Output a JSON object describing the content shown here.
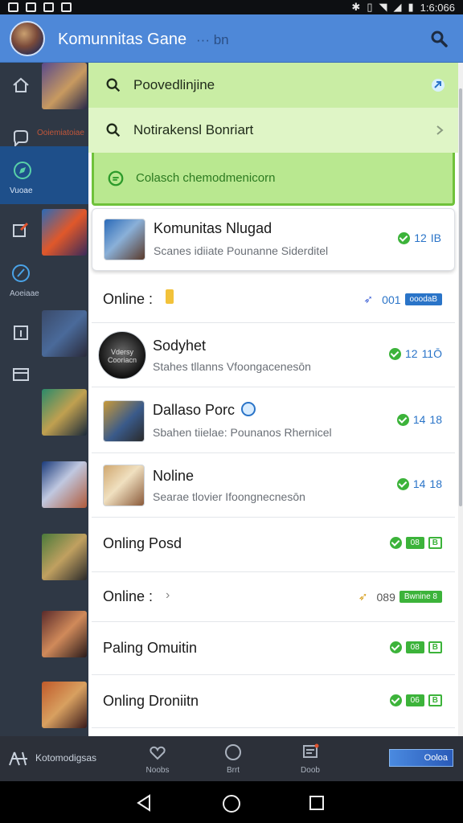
{
  "status": {
    "time": "1:6:066"
  },
  "appbar": {
    "title": "Komunnitas Gane",
    "suffix": "··· bn",
    "search_icon": "search-icon"
  },
  "rail": {
    "items": [
      {
        "label": ""
      },
      {
        "label": "Ooiemiatoiae"
      },
      {
        "label": "Vuoae"
      },
      {
        "label": ""
      },
      {
        "label": "Aoeiaae"
      },
      {
        "label": ""
      },
      {
        "label": ""
      }
    ]
  },
  "search": {
    "row1": "Poovedlinjine",
    "row2": "Notirakensl Bonriart",
    "row3": "Colasch chemodmenicorn"
  },
  "cards": [
    {
      "title": "Komunitas Nlugad",
      "subtitle": "Scanes idiiate  Pounanne Siderditel",
      "count": "12",
      "badge": "IB"
    },
    {
      "title": "Online :",
      "count": "001",
      "pill": "ooodaB"
    },
    {
      "title": "Sodyhet",
      "subtitle": "Stahes tllanns Vfoongacenesōn",
      "count": "12",
      "badge": "11Ō",
      "avatar_text": "Vdersy Cooriacn"
    },
    {
      "title": "Dallaso Porc",
      "subtitle": "Sbahen tiielae:  Pounanos Rhernicel",
      "count": "14",
      "badge": "18"
    },
    {
      "title": "Noline",
      "subtitle": "Searae tlovier  Ifoongnecnesōn",
      "count": "14",
      "badge": "18"
    },
    {
      "title": "Onling Posd",
      "count": "08",
      "badge": "B"
    },
    {
      "title": "Online :",
      "count": "089",
      "pill": "Bwnine 8"
    },
    {
      "title": "Paling Omuitin",
      "count": "08",
      "badge": "B"
    },
    {
      "title": "Onling Droniitn",
      "count": "06",
      "badge": "B"
    }
  ],
  "bottomnav": {
    "brand": "Kotomodigsas",
    "items": [
      {
        "label": "Noobs"
      },
      {
        "label": "Brrt"
      },
      {
        "label": "Doob"
      }
    ],
    "promo": "Ooloa"
  }
}
